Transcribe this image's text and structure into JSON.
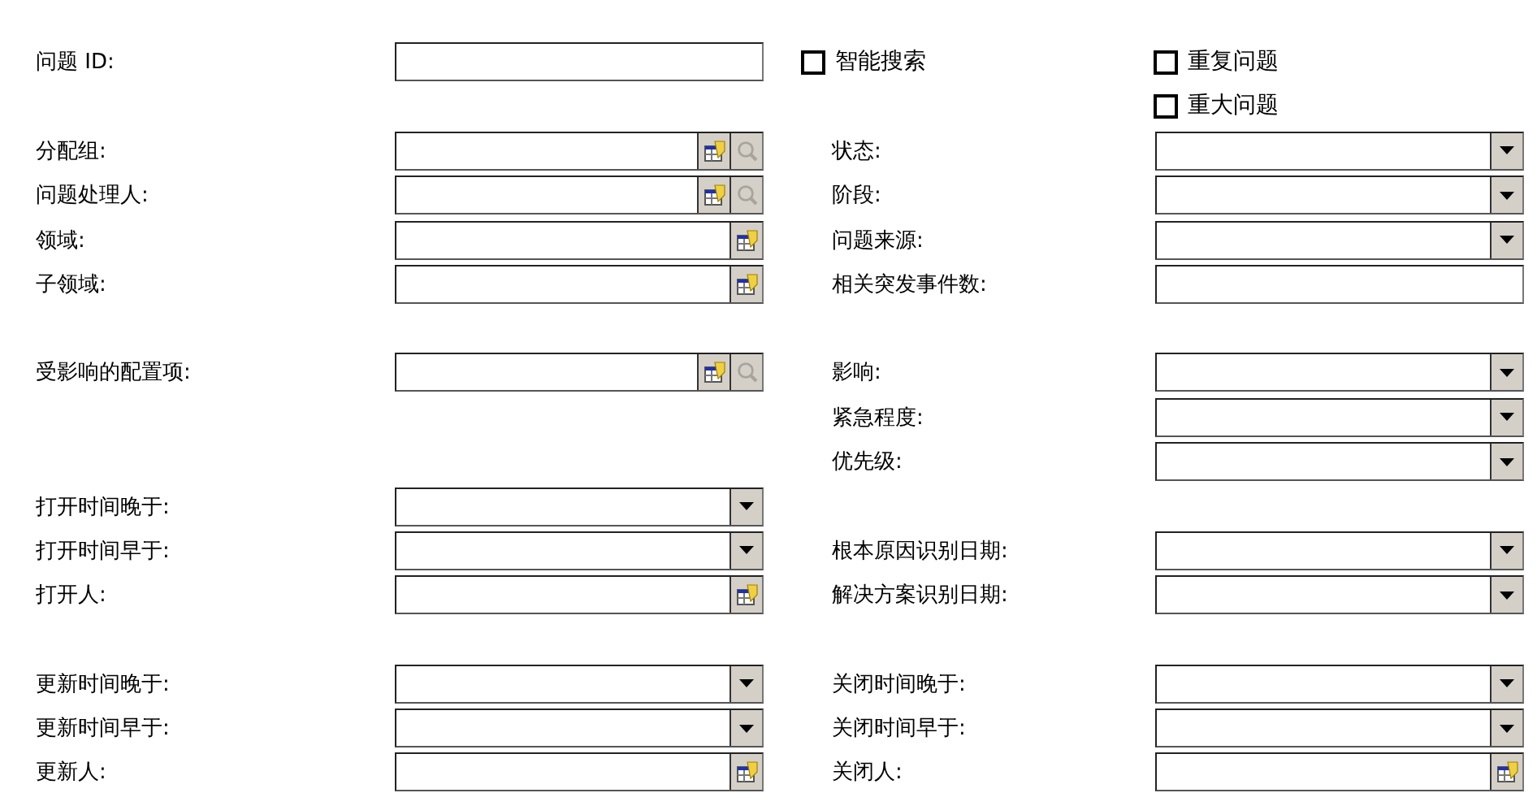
{
  "sections": [
    {
      "rows": [
        {
          "left": {
            "label": {
              "kind": "text",
              "text": "问题 ID:"
            },
            "control": {
              "kind": "text"
            }
          },
          "right": {
            "label": {
              "kind": "checkbox",
              "text": "智能搜索",
              "checked": false
            },
            "control": {
              "kind": "checkbox",
              "text": "重复问题",
              "checked": false
            }
          }
        },
        {
          "right": {
            "control": {
              "kind": "checkbox",
              "text": "重大问题",
              "checked": false
            }
          }
        },
        {
          "left": {
            "label": {
              "kind": "text",
              "text": "分配组:"
            },
            "control": {
              "kind": "lookup_search"
            }
          },
          "right": {
            "label": {
              "kind": "text",
              "text": "状态:"
            },
            "control": {
              "kind": "dropdown"
            }
          }
        },
        {
          "left": {
            "label": {
              "kind": "text",
              "text": "问题处理人:"
            },
            "control": {
              "kind": "lookup_search"
            }
          },
          "right": {
            "label": {
              "kind": "text",
              "text": "阶段:"
            },
            "control": {
              "kind": "dropdown"
            }
          }
        },
        {
          "left": {
            "label": {
              "kind": "text",
              "text": "领域:"
            },
            "control": {
              "kind": "lookup"
            }
          },
          "right": {
            "label": {
              "kind": "text",
              "text": "问题来源:"
            },
            "control": {
              "kind": "dropdown"
            }
          }
        },
        {
          "left": {
            "label": {
              "kind": "text",
              "text": "子领域:"
            },
            "control": {
              "kind": "lookup"
            }
          },
          "right": {
            "label": {
              "kind": "text",
              "text": "相关突发事件数:"
            },
            "control": {
              "kind": "text"
            }
          }
        }
      ]
    },
    {
      "rows": [
        {
          "left": {
            "label": {
              "kind": "text",
              "text": "受影响的配置项:"
            },
            "control": {
              "kind": "lookup_search"
            }
          },
          "right": {
            "label": {
              "kind": "text",
              "text": "影响:"
            },
            "control": {
              "kind": "dropdown"
            }
          }
        },
        {
          "right": {
            "label": {
              "kind": "text",
              "text": "紧急程度:"
            },
            "control": {
              "kind": "dropdown"
            }
          }
        },
        {
          "right": {
            "label": {
              "kind": "text",
              "text": "优先级:"
            },
            "control": {
              "kind": "dropdown"
            }
          }
        },
        {
          "left": {
            "label": {
              "kind": "text",
              "text": "打开时间晚于:"
            },
            "control": {
              "kind": "dropdown"
            }
          }
        },
        {
          "left": {
            "label": {
              "kind": "text",
              "text": "打开时间早于:"
            },
            "control": {
              "kind": "dropdown"
            }
          },
          "right": {
            "label": {
              "kind": "text",
              "text": "根本原因识别日期:"
            },
            "control": {
              "kind": "dropdown"
            }
          }
        },
        {
          "left": {
            "label": {
              "kind": "text",
              "text": "打开人:"
            },
            "control": {
              "kind": "lookup"
            }
          },
          "right": {
            "label": {
              "kind": "text",
              "text": "解决方案识别日期:"
            },
            "control": {
              "kind": "dropdown"
            }
          }
        }
      ]
    },
    {
      "rows": [
        {
          "left": {
            "label": {
              "kind": "text",
              "text": "更新时间晚于:"
            },
            "control": {
              "kind": "dropdown"
            }
          },
          "right": {
            "label": {
              "kind": "text",
              "text": "关闭时间晚于:"
            },
            "control": {
              "kind": "dropdown"
            }
          }
        },
        {
          "left": {
            "label": {
              "kind": "text",
              "text": "更新时间早于:"
            },
            "control": {
              "kind": "dropdown"
            }
          },
          "right": {
            "label": {
              "kind": "text",
              "text": "关闭时间早于:"
            },
            "control": {
              "kind": "dropdown"
            }
          }
        },
        {
          "left": {
            "label": {
              "kind": "text",
              "text": "更新人:"
            },
            "control": {
              "kind": "lookup"
            }
          },
          "right": {
            "label": {
              "kind": "text",
              "text": "关闭人:"
            },
            "control": {
              "kind": "lookup"
            }
          }
        }
      ]
    }
  ]
}
